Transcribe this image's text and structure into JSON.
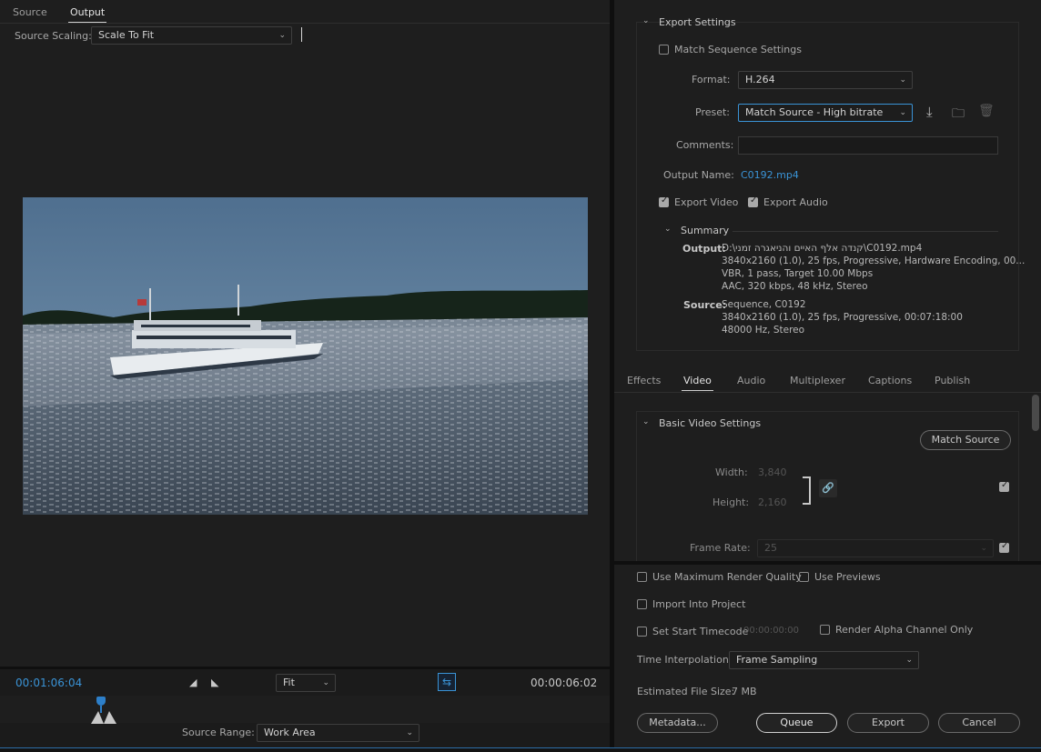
{
  "preview": {
    "tabs": [
      "Source",
      "Output"
    ],
    "scaling_label": "Source Scaling:",
    "scaling_value": "Scale To Fit",
    "current_time": "00:01:06:04",
    "zoom_value": "Fit",
    "duration": "00:00:06:02",
    "source_range_label": "Source Range:",
    "source_range_value": "Work Area"
  },
  "export_settings": {
    "section_title": "Export Settings",
    "match_sequence": "Match Sequence Settings",
    "format_label": "Format:",
    "format_value": "H.264",
    "preset_label": "Preset:",
    "preset_value": "Match Source - High bitrate",
    "comments_label": "Comments:",
    "output_name_label": "Output Name:",
    "output_name_value": "C0192.mp4",
    "export_video": "Export Video",
    "export_audio": "Export Audio"
  },
  "summary": {
    "title": "Summary",
    "output_label": "Output:",
    "output_lines": [
      "D:\\קנדה אלף האיים והניאגרה זמני\\C0192.mp4",
      "3840x2160 (1.0), 25 fps, Progressive, Hardware Encoding, 00...",
      "VBR, 1 pass, Target 10.00 Mbps",
      "AAC, 320 kbps, 48 kHz, Stereo"
    ],
    "source_label": "Source:",
    "source_lines": [
      "Sequence, C0192",
      "3840x2160 (1.0), 25 fps, Progressive, 00:07:18:00",
      "48000 Hz, Stereo"
    ]
  },
  "settings_tabs": [
    "Effects",
    "Video",
    "Audio",
    "Multiplexer",
    "Captions",
    "Publish"
  ],
  "video": {
    "section_title": "Basic Video Settings",
    "match_source": "Match Source",
    "width_label": "Width:",
    "width_value": "3,840",
    "height_label": "Height:",
    "height_value": "2,160",
    "frame_rate_label": "Frame Rate:",
    "frame_rate_value": "25"
  },
  "bottom": {
    "max_render": "Use Maximum Render Quality",
    "use_previews": "Use Previews",
    "import_project": "Import Into Project",
    "start_timecode": "Set Start Timecode",
    "start_timecode_value": "00:00:00:00",
    "render_alpha": "Render Alpha Channel Only",
    "time_interp_label": "Time Interpolation:",
    "time_interp_value": "Frame Sampling",
    "est_size_label": "Estimated File Size:",
    "est_size_value": "7 MB",
    "metadata": "Metadata...",
    "queue": "Queue",
    "export": "Export",
    "cancel": "Cancel"
  }
}
